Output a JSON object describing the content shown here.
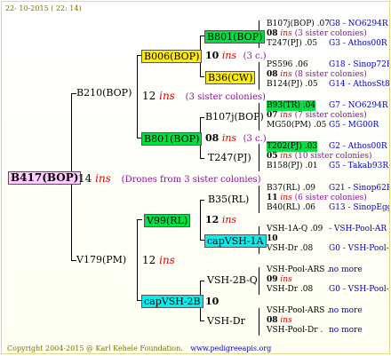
{
  "header": {
    "date": "22- 10-2015 ( 22: 14)"
  },
  "footer": {
    "copyright": "Copyright 2004-2015 @ Karl Kehele Foundation.",
    "site": "www.pedigreeapis.org"
  },
  "root": {
    "name": "B417(BOP)",
    "gen": "14",
    "ins": "ins",
    "note": "(Drones from 3 sister colonies)"
  },
  "p1": {
    "name": "B210(BOP)",
    "gen": "12",
    "ins": "ins",
    "note": "(3 sister colonies)"
  },
  "p2": {
    "name": "V179(PM)",
    "gen": "12",
    "ins": "ins"
  },
  "gp": [
    {
      "name": "B006(BOP)",
      "gen": "10",
      "ins": "ins",
      "note": "(3 c.)"
    },
    {
      "name": "B801(BOP)",
      "gen": "08",
      "ins": "ins",
      "note": "(3 c.)"
    },
    {
      "name": "V99(RL)",
      "gen": "12",
      "ins": "ins"
    },
    {
      "name": "capVSH-2B",
      "gen": "10"
    }
  ],
  "ggp": [
    {
      "name": "B801(BOP)"
    },
    {
      "name": "B36(CW)"
    },
    {
      "name": "B107j(BOP)"
    },
    {
      "name": "T247(PJ)"
    },
    {
      "name": "B35(RL)",
      "gen": "11",
      "ins": "ins"
    },
    {
      "name": "capVSH-1A",
      "gen": "10"
    },
    {
      "name": "VSH-2B-Q",
      "gen": "09"
    },
    {
      "name": "VSH-Dr",
      "gen": "08"
    }
  ],
  "rows": [
    {
      "top": "B107j(BOP) .07",
      "topr": "G8 - NO6294R",
      "mid": "08",
      "ins": "ins",
      "note": "(3 sister colonies)",
      "bot": "T247(PJ) .05",
      "botr": "G3 - Athos00R"
    },
    {
      "top": "PS596 .06",
      "topr": "G18 - Sinop72R",
      "mid": "08",
      "ins": "ins",
      "note": "(8 sister colonies)",
      "bot": "B124(PJ) .05",
      "botr": "G14 - AthosSt80R"
    },
    {
      "top": "B93(TR) .04",
      "topr": "G7 - NO6294R",
      "mid": "07",
      "ins": "ins",
      "note": "(7 sister colonies)",
      "bot": "MG50(PM) .05",
      "botr": "G5 - MG00R"
    },
    {
      "top": "T202(PJ) .03",
      "topr": "G2 - Athos00R",
      "mid": "05",
      "ins": "ins",
      "note": "(10 sister colonies)",
      "bot": "B158(PJ) .01",
      "botr": "G5 - Takab93R"
    },
    {
      "top": "B37(RL) .09",
      "topr": "G21 - Sinop62R",
      "mid": "11",
      "ins": "ins",
      "note": "(6 sister colonies)",
      "bot": "B40(RL) .06",
      "botr": "G13 - SinopEgg86R"
    },
    {
      "top": "VSH-1A-Q .09",
      "topr": "- VSH-Pool-AR",
      "mid": "10",
      "ins": "",
      "note": "",
      "bot": "VSH-Dr .08",
      "botr": "G0 - VSH-Pool-AR"
    },
    {
      "top": "VSH-Pool-ARS .",
      "topr": "no more",
      "mid": "09",
      "ins": "ins",
      "note": "",
      "bot": "VSH-Dr .08",
      "botr": "G0 - VSH-Pool-AR"
    },
    {
      "top": "VSH-Pool-ARS .",
      "topr": "no more",
      "mid": "08",
      "ins": "ins",
      "note": "",
      "bot": "VSH-Pool-Dr .",
      "botr": "no more"
    }
  ]
}
